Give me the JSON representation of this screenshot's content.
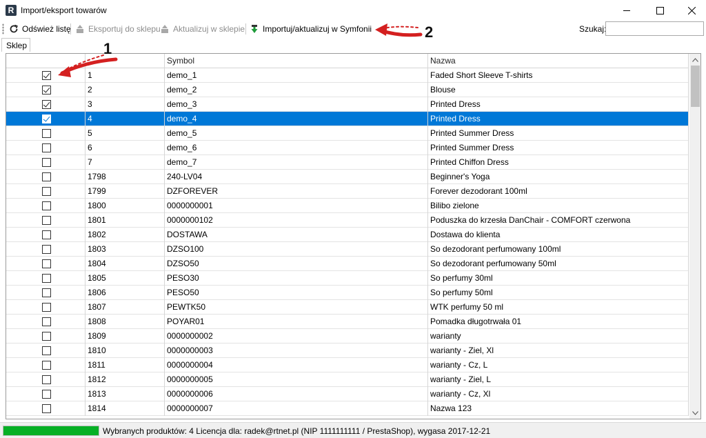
{
  "window": {
    "title": "Import/eksport towarów",
    "app_icon_letter": "R"
  },
  "toolbar": {
    "refresh_label": "Odśwież listę",
    "export_label": "Eksportuj do sklepu",
    "update_shop_label": "Aktualizuj w sklepie",
    "import_label": "Importuj/aktualizuj w Symfonii",
    "search_label": "Szukaj:",
    "search_value": ""
  },
  "tabs": [
    {
      "label": "Sklep",
      "active": true
    }
  ],
  "grid": {
    "columns": [
      "",
      "",
      "Symbol",
      "Nazwa"
    ],
    "rows": [
      {
        "checked": true,
        "id": "1",
        "symbol": "demo_1",
        "name": "Faded Short Sleeve T-shirts",
        "selected": false
      },
      {
        "checked": true,
        "id": "2",
        "symbol": "demo_2",
        "name": "Blouse",
        "selected": false
      },
      {
        "checked": true,
        "id": "3",
        "symbol": "demo_3",
        "name": "Printed Dress",
        "selected": false
      },
      {
        "checked": true,
        "id": "4",
        "symbol": "demo_4",
        "name": "Printed Dress",
        "selected": true
      },
      {
        "checked": false,
        "id": "5",
        "symbol": "demo_5",
        "name": "Printed Summer Dress",
        "selected": false
      },
      {
        "checked": false,
        "id": "6",
        "symbol": "demo_6",
        "name": "Printed Summer Dress",
        "selected": false
      },
      {
        "checked": false,
        "id": "7",
        "symbol": "demo_7",
        "name": "Printed Chiffon Dress",
        "selected": false
      },
      {
        "checked": false,
        "id": "1798",
        "symbol": "240-LV04",
        "name": "Beginner's Yoga",
        "selected": false
      },
      {
        "checked": false,
        "id": "1799",
        "symbol": "DZFOREVER",
        "name": "Forever dezodorant 100ml",
        "selected": false
      },
      {
        "checked": false,
        "id": "1800",
        "symbol": "0000000001",
        "name": "Bilibo zielone",
        "selected": false
      },
      {
        "checked": false,
        "id": "1801",
        "symbol": "0000000102",
        "name": "Poduszka do krzesła DanChair - COMFORT czerwona",
        "selected": false
      },
      {
        "checked": false,
        "id": "1802",
        "symbol": "DOSTAWA",
        "name": "Dostawa do klienta",
        "selected": false
      },
      {
        "checked": false,
        "id": "1803",
        "symbol": "DZSO100",
        "name": "So dezodorant perfumowany 100ml",
        "selected": false
      },
      {
        "checked": false,
        "id": "1804",
        "symbol": "DZSO50",
        "name": "So dezodorant perfumowany 50ml",
        "selected": false
      },
      {
        "checked": false,
        "id": "1805",
        "symbol": "PESO30",
        "name": "So perfumy 30ml",
        "selected": false
      },
      {
        "checked": false,
        "id": "1806",
        "symbol": "PESO50",
        "name": "So perfumy 50ml",
        "selected": false
      },
      {
        "checked": false,
        "id": "1807",
        "symbol": "PEWTK50",
        "name": "WTK perfumy 50 ml",
        "selected": false
      },
      {
        "checked": false,
        "id": "1808",
        "symbol": "POYAR01",
        "name": "Pomadka długotrwała 01",
        "selected": false
      },
      {
        "checked": false,
        "id": "1809",
        "symbol": "0000000002",
        "name": "warianty",
        "selected": false
      },
      {
        "checked": false,
        "id": "1810",
        "symbol": "0000000003",
        "name": "warianty - Ziel, Xl",
        "selected": false
      },
      {
        "checked": false,
        "id": "1811",
        "symbol": "0000000004",
        "name": "warianty - Cz, L",
        "selected": false
      },
      {
        "checked": false,
        "id": "1812",
        "symbol": "0000000005",
        "name": "warianty - Ziel, L",
        "selected": false
      },
      {
        "checked": false,
        "id": "1813",
        "symbol": "0000000006",
        "name": "warianty - Cz, Xl",
        "selected": false
      },
      {
        "checked": false,
        "id": "1814",
        "symbol": "0000000007",
        "name": "Nazwa 123",
        "selected": false
      }
    ]
  },
  "status": {
    "text": "Wybranych produktów: 4  Licencja dla: radek@rtnet.pl (NIP 1111111111 / PrestaShop), wygasa 2017-12-21",
    "progress_fraction": 1.0
  },
  "annotations": {
    "marker_1": "1",
    "marker_2": "2"
  },
  "colors": {
    "selection": "#0078d7",
    "progress": "#06b025",
    "arrow": "#d42020"
  }
}
